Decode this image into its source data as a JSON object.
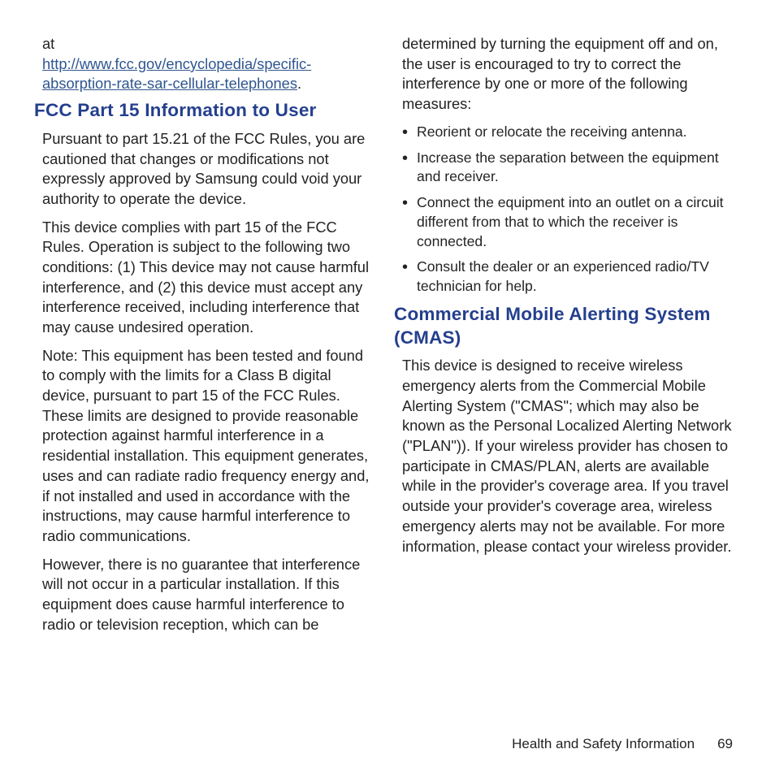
{
  "col1": {
    "intro_prefix": "at",
    "intro_link": "http://www.fcc.gov/encyclopedia/specific-absorption-rate-sar-cellular-telephones",
    "intro_suffix": ".",
    "heading1": "FCC Part 15 Information to User",
    "p1": "Pursuant to part 15.21 of the FCC Rules, you are cautioned that changes or modifications not expressly approved by Samsung could void your authority to operate the device.",
    "p2": "This device complies with part 15 of the FCC Rules. Operation is subject to the following two conditions: (1) This device may not cause harmful interference, and (2) this device must accept any interference received, including interference that may cause undesired operation.",
    "p3": "Note: This equipment has been tested and found to comply with the limits for a Class B digital device, pursuant to part 15 of the FCC Rules. These limits are designed to provide reasonable protection against harmful interference in a residential installation. This equipment generates, uses and can radiate radio frequency energy and, if not installed and used in accordance with the instructions, may cause harmful interference to radio communications.",
    "p4": "However, there is no guarantee that interference will not occur in a particular installation. If this equipment does cause harmful interference to radio or television reception, which can be"
  },
  "col2": {
    "p5": "determined by turning the equipment off and on, the user is encouraged to try to correct the interference by one or more of the following measures:",
    "bullets": [
      "Reorient or relocate the receiving antenna.",
      "Increase the separation between the equipment and receiver.",
      "Connect the equipment into an outlet on a circuit different from that to which the receiver is connected.",
      "Consult the dealer or an experienced radio/TV technician for help."
    ],
    "heading2": "Commercial Mobile Alerting System (CMAS)",
    "p6": "This device is designed to receive wireless emergency alerts from the Commercial Mobile Alerting System (\"CMAS\"; which may also be known as the Personal Localized Alerting Network (\"PLAN\")). If your wireless provider has chosen to participate in CMAS/PLAN, alerts are available while in the provider's coverage area. If you travel outside your provider's coverage area, wireless emergency alerts may not be available. For more information, please contact your wireless provider."
  },
  "footer": {
    "section": "Health and Safety Information",
    "page": "69"
  }
}
